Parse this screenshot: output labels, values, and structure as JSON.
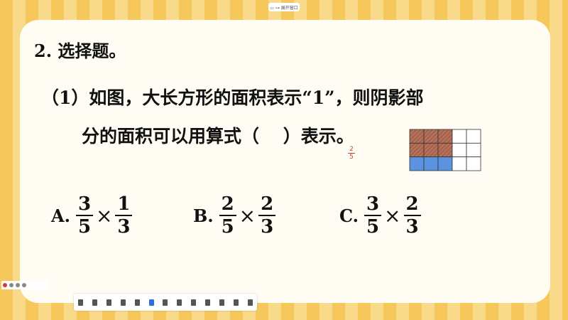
{
  "top_bar": {
    "label": "▭ ⊶ 展开窗口"
  },
  "question": {
    "heading": "2. 选择题。",
    "stem_line1": "（1）如图，大长方形的面积表示“1”，则阴影部",
    "stem_line2": "分的面积可以用算式（　 ）表示。",
    "handwritten_numerator": "2",
    "handwritten_denominator": "5"
  },
  "figure": {
    "rows": 3,
    "cols": 5,
    "colors": {
      "hatched": "#b5715a",
      "blue": "#5b93e0",
      "empty": "#ffffff",
      "line": "#333333"
    },
    "hatched_rows": 2,
    "hatched_cols": 3,
    "blue_row": 3,
    "blue_cols": 3
  },
  "options": [
    {
      "label": "A.",
      "f1_num": "3",
      "f1_den": "5",
      "op": "×",
      "f2_num": "1",
      "f2_den": "3"
    },
    {
      "label": "B.",
      "f1_num": "2",
      "f1_den": "5",
      "op": "×",
      "f2_num": "2",
      "f2_den": "3"
    },
    {
      "label": "C.",
      "f1_num": "3",
      "f1_den": "5",
      "op": "×",
      "f2_num": "2",
      "f2_den": "3"
    }
  ],
  "toolbar_icons": [
    "cursor-icon",
    "move-icon",
    "pen-icon",
    "marker-icon",
    "text-icon",
    "shape-icon",
    "eraser-icon",
    "clear-icon",
    "undo-icon",
    "redo-icon",
    "page-icon",
    "export-icon",
    "more-icon"
  ]
}
